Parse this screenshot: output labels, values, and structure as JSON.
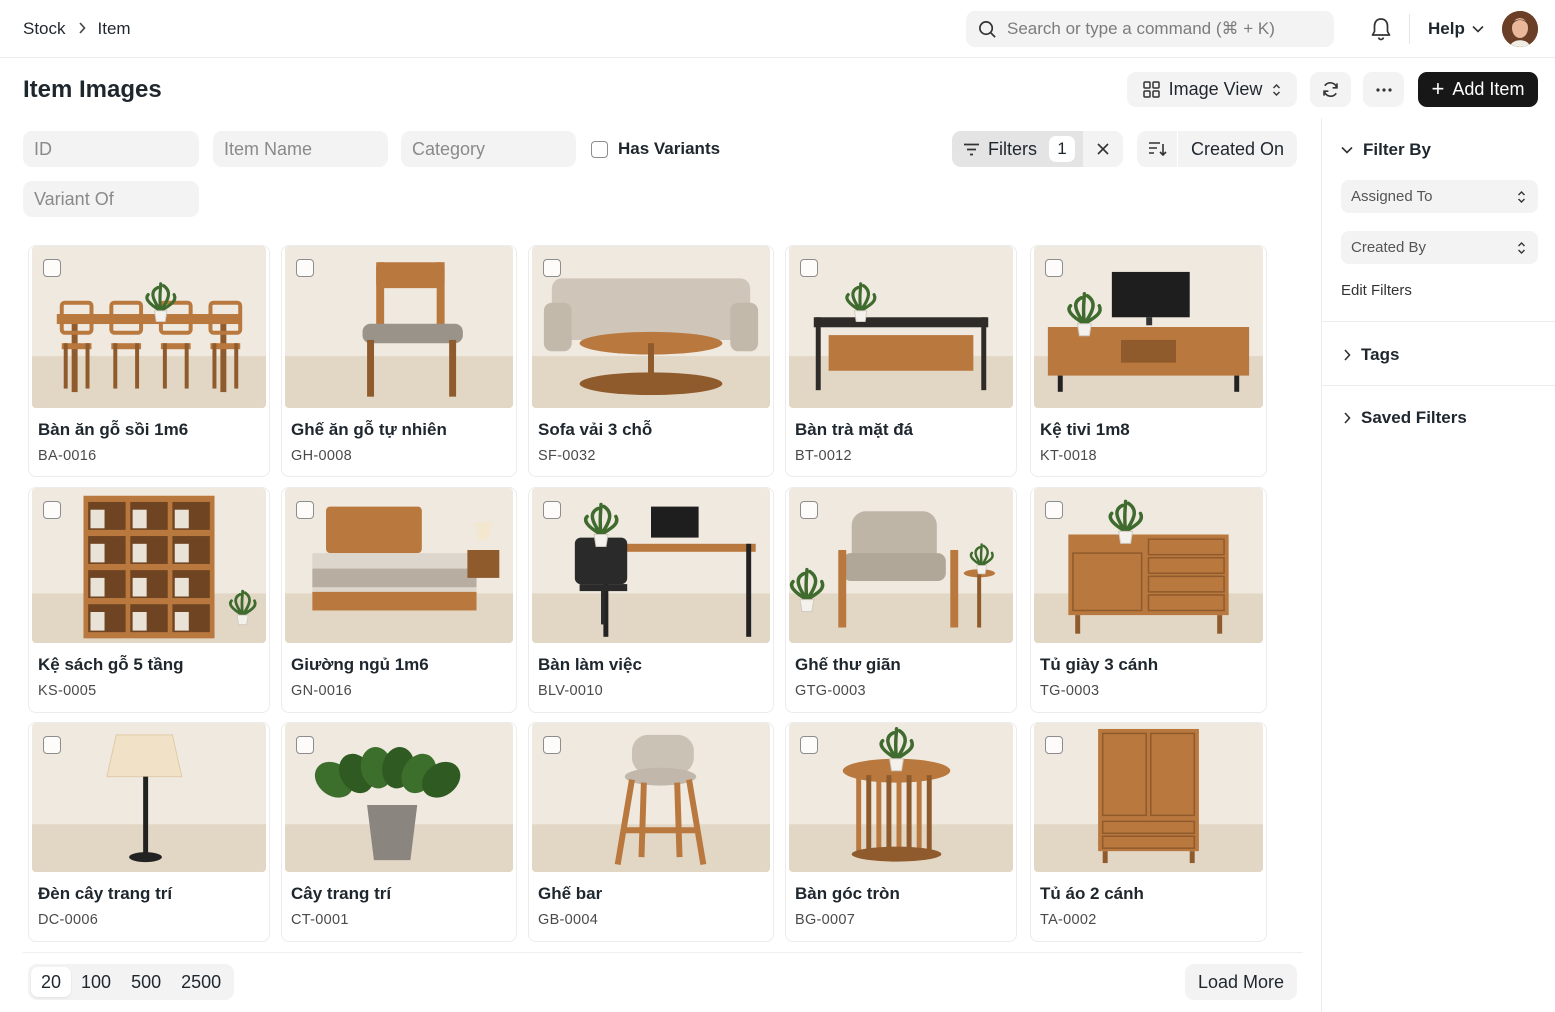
{
  "breadcrumb": [
    "Stock",
    "Item"
  ],
  "search": {
    "placeholder": "Search or type a command (⌘ + K)"
  },
  "nav": {
    "help_label": "Help"
  },
  "page": {
    "title": "Item Images"
  },
  "toolbar": {
    "view_label": "Image View",
    "add_label": "Add Item"
  },
  "filters": {
    "id_placeholder": "ID",
    "name_placeholder": "Item Name",
    "category_placeholder": "Category",
    "has_variants_label": "Has Variants",
    "variant_of_placeholder": "Variant Of",
    "filters_label": "Filters",
    "filters_count": "1",
    "sort_label": "Created On"
  },
  "items": [
    {
      "name": "Bàn ăn gỗ sồi 1m6",
      "code": "BA-0016",
      "icon": "dining-table"
    },
    {
      "name": "Ghế ăn gỗ tự nhiên",
      "code": "GH-0008",
      "icon": "chair"
    },
    {
      "name": "Sofa vải 3 chỗ",
      "code": "SF-0032",
      "icon": "sofa"
    },
    {
      "name": "Bàn trà mặt đá",
      "code": "BT-0012",
      "icon": "coffee-table"
    },
    {
      "name": "Kệ tivi 1m8",
      "code": "KT-0018",
      "icon": "tv-stand"
    },
    {
      "name": "Kệ sách gỗ 5 tầng",
      "code": "KS-0005",
      "icon": "bookshelf"
    },
    {
      "name": "Giường ngủ 1m6",
      "code": "GN-0016",
      "icon": "bed"
    },
    {
      "name": "Bàn làm việc",
      "code": "BLV-0010",
      "icon": "desk"
    },
    {
      "name": "Ghế thư giãn",
      "code": "GTG-0003",
      "icon": "armchair"
    },
    {
      "name": "Tủ giày 3 cánh",
      "code": "TG-0003",
      "icon": "shoe-cabinet"
    },
    {
      "name": "Đèn cây trang trí",
      "code": "DC-0006",
      "icon": "floor-lamp"
    },
    {
      "name": "Cây trang trí",
      "code": "CT-0001",
      "icon": "potted-plant"
    },
    {
      "name": "Ghế bar",
      "code": "GB-0004",
      "icon": "bar-stool"
    },
    {
      "name": "Bàn góc tròn",
      "code": "BG-0007",
      "icon": "round-side-table"
    },
    {
      "name": "Tủ áo 2 cánh",
      "code": "TA-0002",
      "icon": "wardrobe"
    }
  ],
  "paging": {
    "sizes": [
      "20",
      "100",
      "500",
      "2500"
    ],
    "selected": "20",
    "load_more_label": "Load More"
  },
  "sidebar": {
    "filter_by_label": "Filter By",
    "assigned_to_label": "Assigned To",
    "created_by_label": "Created By",
    "edit_filters_label": "Edit Filters",
    "tags_label": "Tags",
    "saved_filters_label": "Saved Filters"
  },
  "colors": {
    "primary_button": "#171717",
    "field_bg": "#f3f3f3",
    "wood": "#b9783e",
    "wall": "#efe9df"
  }
}
